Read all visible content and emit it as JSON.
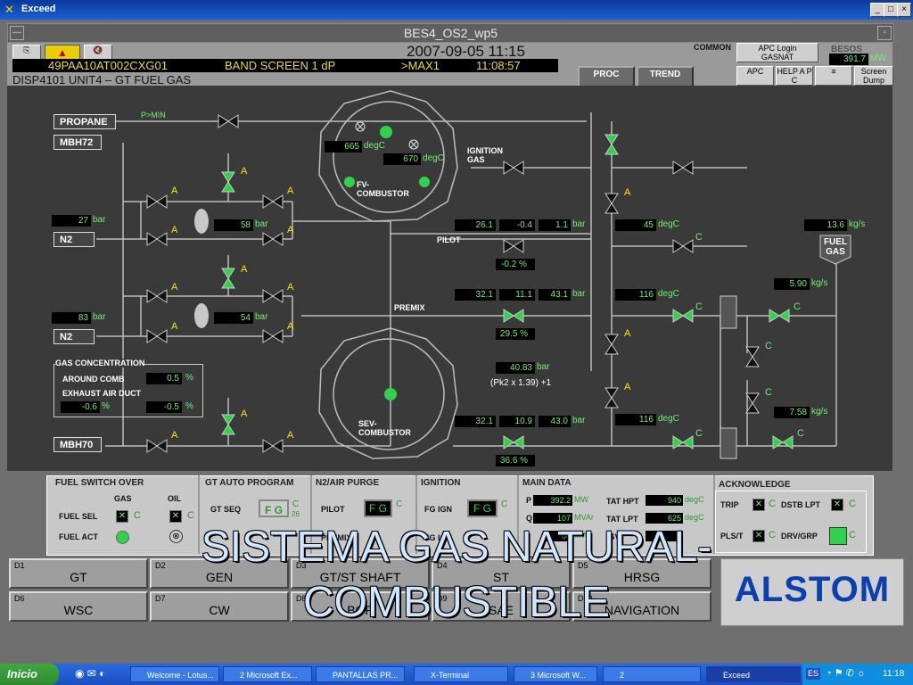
{
  "window": {
    "title": "Exceed",
    "inner_title": "BES4_OS2_wp5",
    "min": "_",
    "max": "□",
    "close": "×"
  },
  "header": {
    "datetime": "2007-09-05 11:15",
    "alarm_tag": "49PAA10AT002CXG01",
    "alarm_text": "BAND SCREEN 1 dP",
    "alarm_limit": ">MAX1",
    "alarm_time": "11:08:57",
    "display": "DISP4101 UNIT4 – GT FUEL GAS",
    "common": "COMMON",
    "apc_login": "APC Login",
    "apc_user": "GASNAT",
    "besos_label": "BESOS",
    "besos_value": "391.7",
    "besos_unit": "MW",
    "proc": "PROC",
    "trend": "TREND",
    "apc": "APC",
    "help_apc": "HELP A P C",
    "screen_dump": "Screen Dump"
  },
  "diagram": {
    "propane": "PROPANE",
    "pmin": "P>MIN",
    "mbh72": "MBH72",
    "mbh70": "MBH70",
    "n2_a": "N2",
    "n2_b": "N2",
    "p27": "27",
    "p27_u": "bar",
    "p58": "58",
    "p58_u": "bar",
    "p83": "83",
    "p83_u": "bar",
    "p54": "54",
    "p54_u": "bar",
    "t665": "665",
    "t665_u": "degC",
    "t670": "670",
    "t670_u": "degC",
    "fv_comb": "FV-\nCOMBUSTOR",
    "sev_comb": "SEV-\nCOMBUSTOR",
    "ignition_gas": "IGNITION\nGAS",
    "pilot": "PILOT",
    "premix": "PREMIX",
    "pilot_vals": [
      "26.1",
      "-0.4",
      "1.1"
    ],
    "pilot_u": "bar",
    "pilot_pct": "-0.2 %",
    "premix_vals": [
      "32.1",
      "11.1",
      "43.1"
    ],
    "premix_u": "bar",
    "premix_pct": "29.5 %",
    "sev_vals": [
      "32.1",
      "10.9",
      "43.0"
    ],
    "sev_u": "bar",
    "sev_pct": "36.6 %",
    "pk2": "40.83",
    "pk2_u": "bar",
    "pk2_formula": "(Pk2 x 1.39) +1",
    "t45": "45",
    "t45_u": "degC",
    "t116a": "116",
    "t116a_u": "degC",
    "t116b": "116",
    "t116b_u": "degC",
    "flow_total": "13.6",
    "flow_total_u": "kg/s",
    "fuel_gas": "FUEL\nGAS",
    "flow_590": "5.90",
    "flow_590_u": "kg/s",
    "flow_758": "7.58",
    "flow_758_u": "kg/s",
    "gas_conc_title": "GAS CONCENTRATION",
    "around_comb": "AROUND COMB",
    "around_val": "0.5",
    "pct": "%",
    "exhaust": "EXHAUST AIR DUCT",
    "exh1": "-0.6",
    "exh2": "-0.5",
    "A": "A",
    "C": "C"
  },
  "panel": {
    "fuel_switch": "FUEL SWITCH OVER",
    "gas": "GAS",
    "oil": "OIL",
    "fuel_sel": "FUEL SEL",
    "fuel_act": "FUEL ACT",
    "gt_auto": "GT AUTO PROGRAM",
    "gt_seq": "GT SEQ",
    "fg": "F G",
    "seq_num": "26",
    "n2_purge": "N2/AIR PURGE",
    "pilot": "PILOT",
    "premix_short": "PREMIX",
    "ignition": "IGNITION",
    "fg_ign": "FG IGN",
    "fg_ign2": "FG IGN",
    "main_data": "MAIN DATA",
    "p_label": "P",
    "p_val": "392.2",
    "p_unit": "MW",
    "q_label": "Q",
    "q_val": "107",
    "q_unit": "MVAr",
    "x_val": "00",
    "x_unit": "MW",
    "tat_hpt": "TAT HPT",
    "tat_hpt_val": "940",
    "tat_unit": "degC",
    "tat_lpt": "TAT LPT",
    "tat_lpt_val": "625",
    "igv": "IGV",
    "igv_val": "1",
    "ack": "ACKNOWLEDGE",
    "trip": "TRIP",
    "dstb_lpt": "DSTB LPT",
    "pls": "PLS/T",
    "drv_grp": "DRV/GRP",
    "c": "C"
  },
  "nav": [
    {
      "key": "D1",
      "name": "GT"
    },
    {
      "key": "D2",
      "name": "GEN"
    },
    {
      "key": "D3",
      "name": "GT/ST SHAFT"
    },
    {
      "key": "D4",
      "name": "ST"
    },
    {
      "key": "D5",
      "name": "HRSG"
    },
    {
      "key": "D6",
      "name": "WSC"
    },
    {
      "key": "D7",
      "name": "CW"
    },
    {
      "key": "D8",
      "name": "BOP"
    },
    {
      "key": "D9",
      "name": "SAE"
    },
    {
      "key": "D10",
      "name": "NAVIGATION"
    }
  ],
  "overlay": {
    "line1": "SISTEMA GAS NATURAL-",
    "line2": "COMBUSTIBLE"
  },
  "logo": "ALSTOM",
  "taskbar": {
    "start": "Inicio",
    "items": [
      "Welcome - Lotus...",
      "2 Microsoft Ex...",
      "PANTALLAS PR...",
      "X-Terminal",
      "3 Microsoft W...",
      "2",
      "Exceed"
    ],
    "lang": "ES",
    "time": "11:18"
  },
  "colors": {
    "valve_green": "#2fd24a",
    "valve_black": "#111111",
    "value_text": "#6ef06e",
    "alarm_text": "#e8d84a"
  }
}
